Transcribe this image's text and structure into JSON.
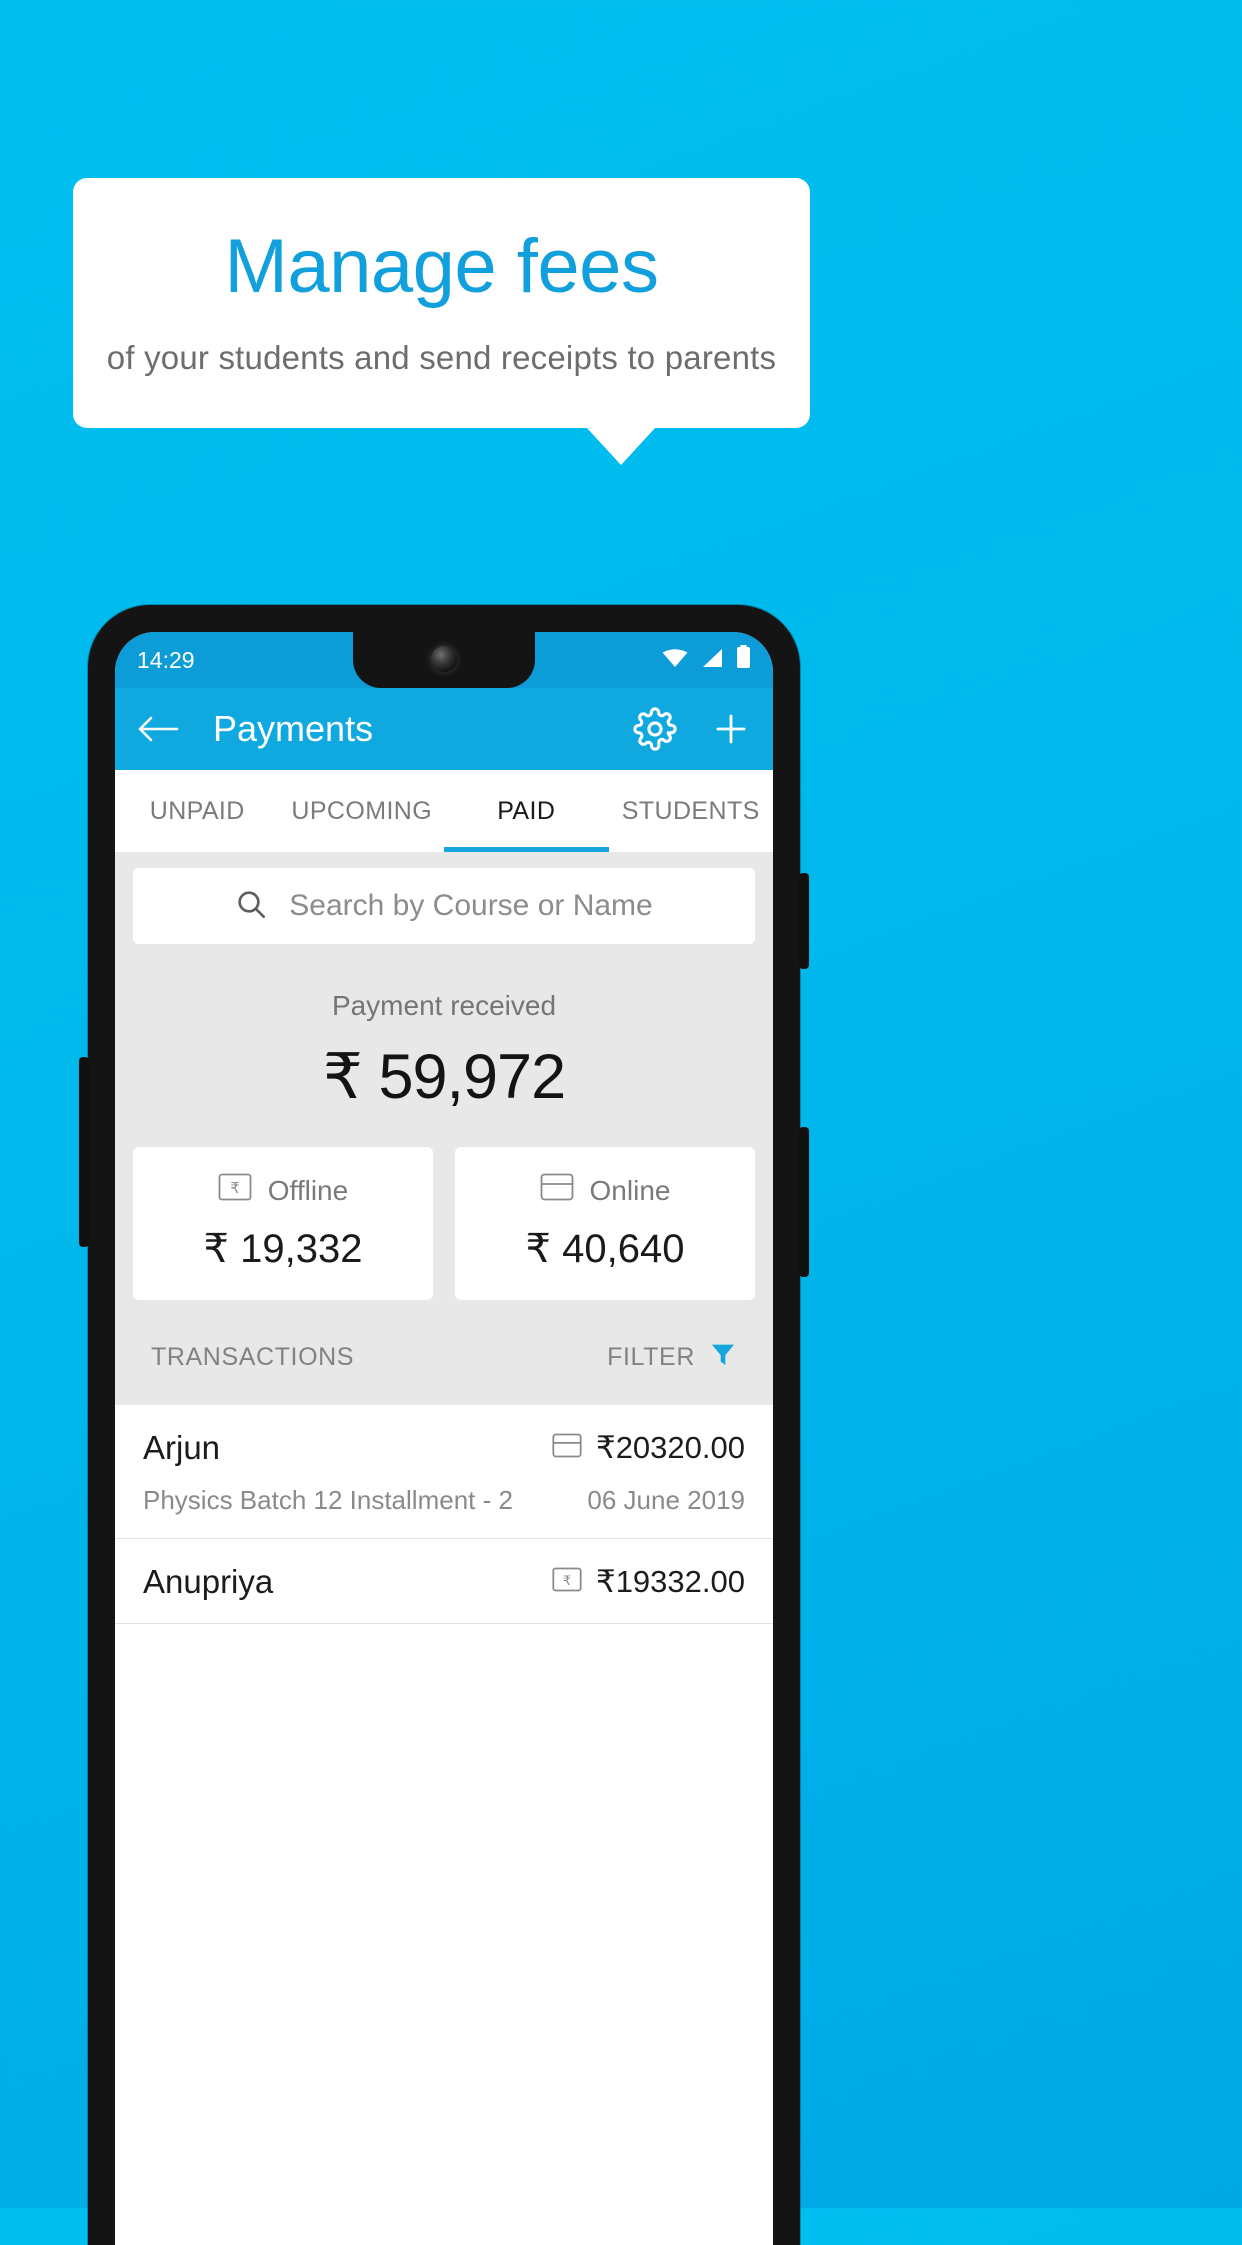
{
  "promo": {
    "headline": "Manage fees",
    "subhead": "of your students and send receipts to parents"
  },
  "colors": {
    "background": "#00bcef",
    "accent": "#0fa9e0",
    "statusbar": "#0c9cd8",
    "headline": "#12a0dc",
    "filter_icon": "#17a5dd",
    "content_bg": "#e8e8e8"
  },
  "phone": {
    "statusbar": {
      "time": "14:29",
      "icons": [
        "wifi-icon",
        "signal-icon",
        "battery-icon"
      ]
    },
    "appbar": {
      "back_icon": "back-arrow-icon",
      "title": "Payments",
      "settings_icon": "gear-icon",
      "add_icon": "plus-icon"
    },
    "tabs": [
      {
        "label": "UNPAID",
        "active": false
      },
      {
        "label": "UPCOMING",
        "active": false
      },
      {
        "label": "PAID",
        "active": true
      },
      {
        "label": "STUDENTS",
        "active": false
      }
    ],
    "search": {
      "icon": "search-icon",
      "placeholder": "Search by Course or Name",
      "value": ""
    },
    "summary": {
      "label": "Payment received",
      "amount": "₹ 59,972",
      "cards": [
        {
          "icon": "rupee-note-icon",
          "label": "Offline",
          "amount": "₹ 19,332"
        },
        {
          "icon": "credit-card-icon",
          "label": "Online",
          "amount": "₹ 40,640"
        }
      ]
    },
    "list_header": {
      "title": "TRANSACTIONS",
      "filter_label": "FILTER",
      "filter_icon": "funnel-icon"
    },
    "transactions": [
      {
        "name": "Arjun",
        "method_icon": "credit-card-icon",
        "amount": "₹20320.00",
        "description": "Physics Batch 12 Installment - 2",
        "date": "06 June 2019"
      },
      {
        "name": "Anupriya",
        "method_icon": "rupee-note-icon",
        "amount": "₹19332.00",
        "description": "",
        "date": ""
      }
    ]
  }
}
